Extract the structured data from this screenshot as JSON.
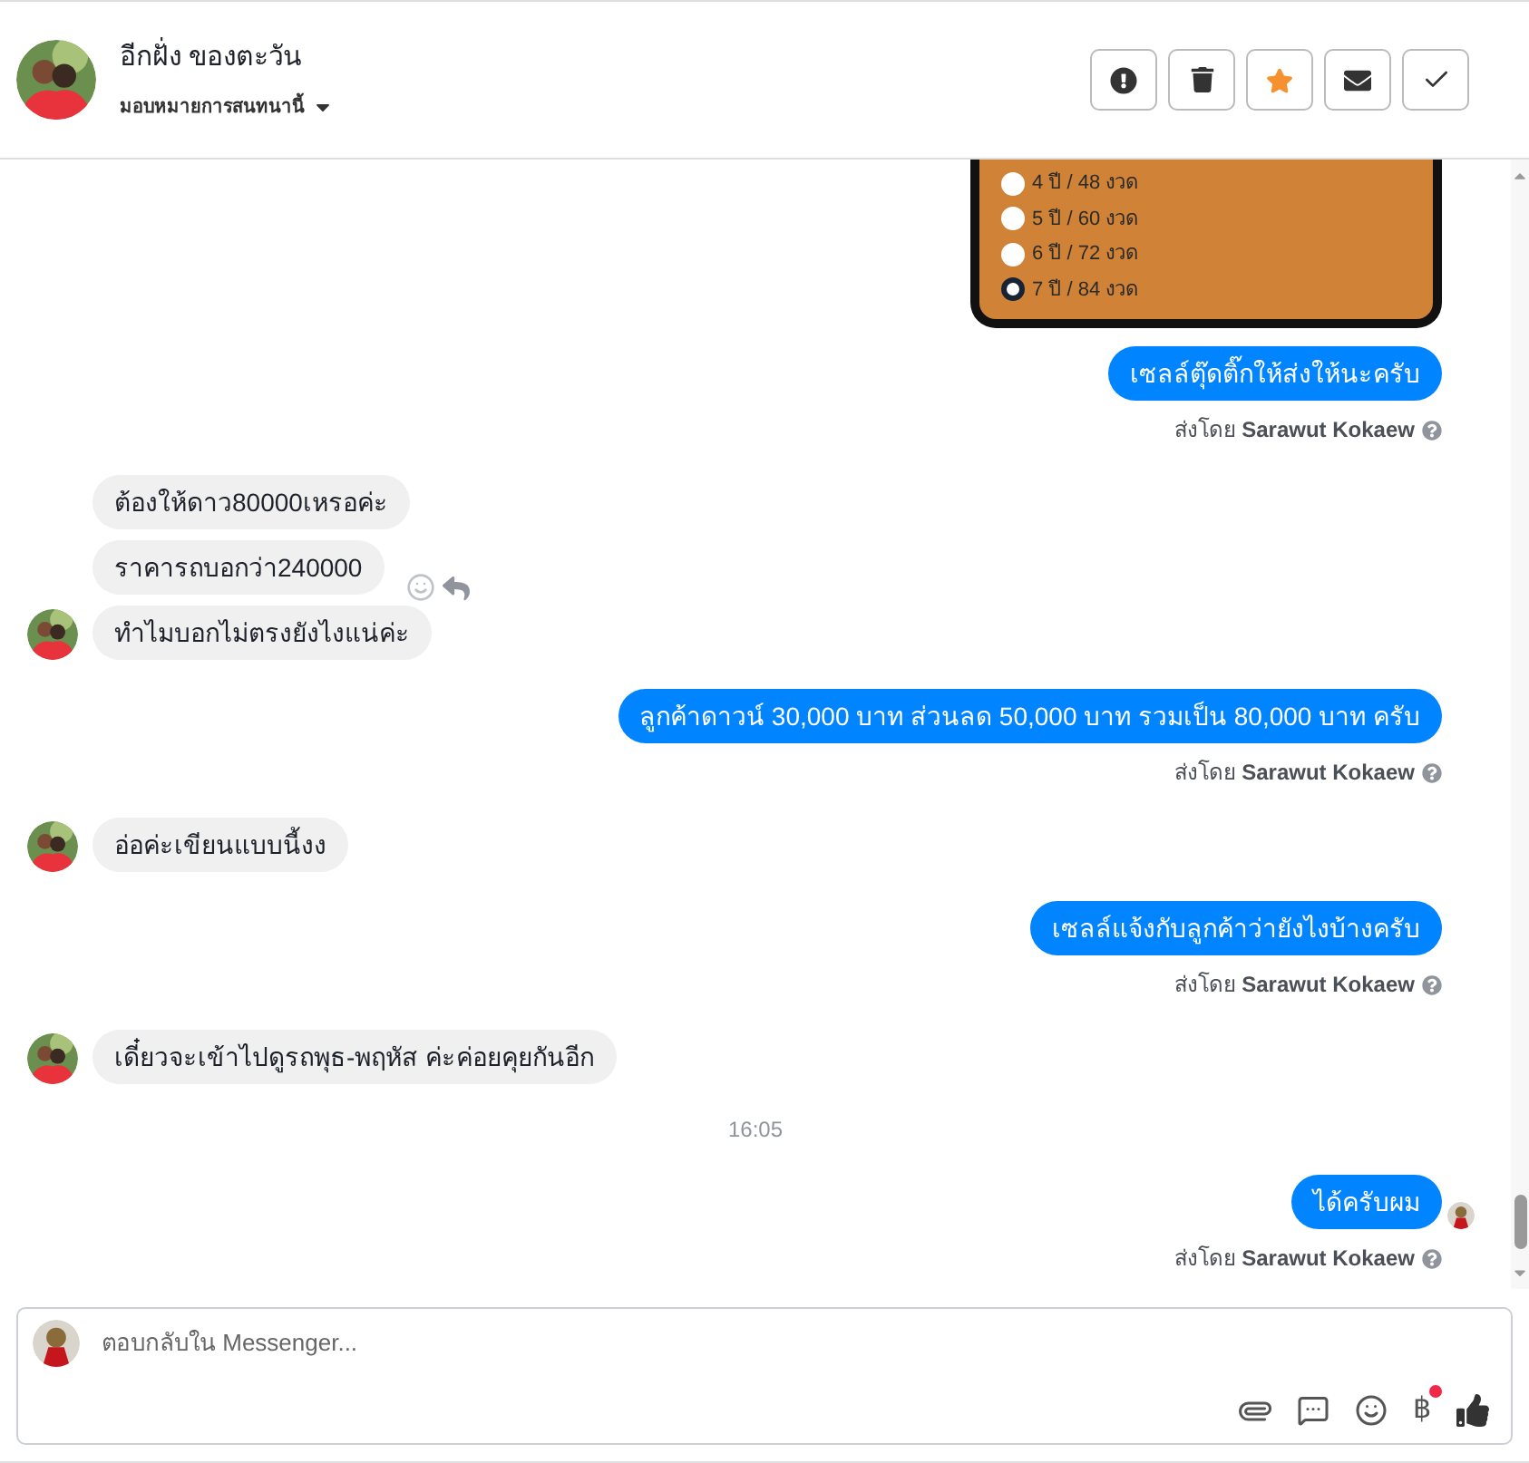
{
  "header": {
    "name": "อีกฝั่ง ของตะวัน",
    "assign_label": "มอบหมายการสนทนานี้",
    "actions": [
      {
        "kind": "spam"
      },
      {
        "kind": "delete"
      },
      {
        "kind": "star",
        "on": true
      },
      {
        "kind": "unread"
      },
      {
        "kind": "done"
      }
    ]
  },
  "messages": [
    {
      "kind": "attachment",
      "options": [
        {
          "label": "4 ปี / 48 งวด",
          "selected": false
        },
        {
          "label": "5 ปี / 60 งวด",
          "selected": false
        },
        {
          "label": "6 ปี / 72 งวด",
          "selected": false
        },
        {
          "label": "7 ปี / 84 งวด",
          "selected": true
        }
      ]
    },
    {
      "kind": "outgoing",
      "text": "เซลล์ตุ๊ดติ๊กให้ส่งให้นะครับ",
      "sent_by": "ส่งโดย **Sarawut Kokaew**",
      "seen": false
    },
    {
      "kind": "incoming",
      "bubbles": [
        {
          "text": "ต้องให้ดาว80000เหรอค่ะ",
          "hover_actions": false
        },
        {
          "text": "ราคารถบอกว่า240000",
          "hover_actions": true
        },
        {
          "text": "ทำไมบอกไม่ตรงยังไงแน่ค่ะ",
          "hover_actions": false
        }
      ]
    },
    {
      "kind": "outgoing",
      "text": "ลูกค้าดาวน์ 30,000 บาท ส่วนลด 50,000 บาท รวมเป็น 80,000 บาท ครับ",
      "sent_by": "ส่งโดย **Sarawut Kokaew**",
      "seen": false
    },
    {
      "kind": "incoming",
      "bubbles": [
        {
          "text": "อ่อค่ะเขียนแบบนี้งง",
          "hover_actions": false
        }
      ]
    },
    {
      "kind": "outgoing",
      "text": "เซลล์แจ้งกับลูกค้าว่ายังไงบ้างครับ",
      "sent_by": "ส่งโดย **Sarawut Kokaew**",
      "seen": false
    },
    {
      "kind": "incoming",
      "bubbles": [
        {
          "text": "เดี๋ยวจะเข้าไปดูรถพุธ-พฤหัส ค่ะค่อยคุยกันอีก",
          "hover_actions": false
        }
      ]
    },
    {
      "kind": "time",
      "text": "16:05"
    },
    {
      "kind": "outgoing",
      "text": "ได้ครับผม",
      "sent_by": "ส่งโดย **Sarawut Kokaew**",
      "seen": true
    }
  ],
  "composer": {
    "placeholder": "ตอบกลับใน Messenger...",
    "currency_symbol": "฿",
    "payment_alert": true
  }
}
